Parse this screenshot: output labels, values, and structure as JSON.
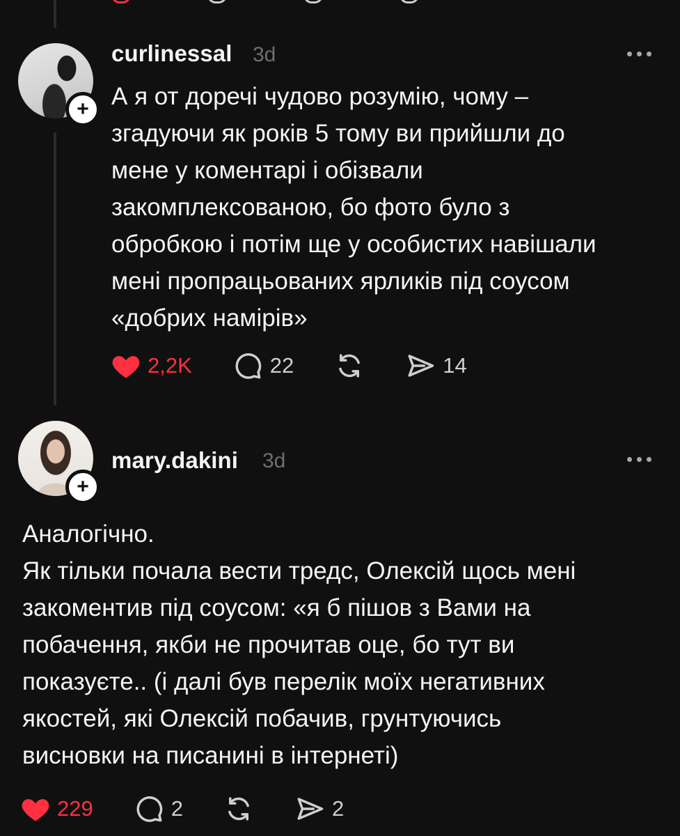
{
  "posts": [
    {
      "username": "curlinessal",
      "time": "3d",
      "text": "А я от доречі чудово розумію, чому –\nзгадуючи як років 5 тому ви прийшли до\nмене у коментарі і обізвали\nзакомплексованою, бо фото було з\nобробкою і потім ще у особистих навішали\nмені пропрацьованих ярликів під соусом\n«добрих намірів»",
      "likes": "2,2K",
      "replies": "22",
      "shares": "14",
      "liked": true
    },
    {
      "username": "mary.dakini",
      "time": "3d",
      "text": "Аналогічно.\nЯк тільки почала вести тредс, Олексій щось мені\nзакоментив під соусом: «я б пішов з Вами на\nпобачення, якби не прочитав оце, бо тут ви\nпоказуєте.. (і далі був перелік моїх негативних\nякостей, які Олексій побачив, грунтуючись\nвисновки на писанині в інтернеті)",
      "likes": "229",
      "replies": "2",
      "shares": "2",
      "liked": true
    }
  ],
  "icons": {
    "like": "heart-icon",
    "reply": "comment-icon",
    "repost": "repost-icon",
    "share": "send-icon",
    "more": "more-icon",
    "follow": "plus-icon"
  },
  "colors": {
    "background": "#101010",
    "text": "#f3f5f7",
    "muted": "#6e6e6e",
    "liked": "#ff3040"
  }
}
